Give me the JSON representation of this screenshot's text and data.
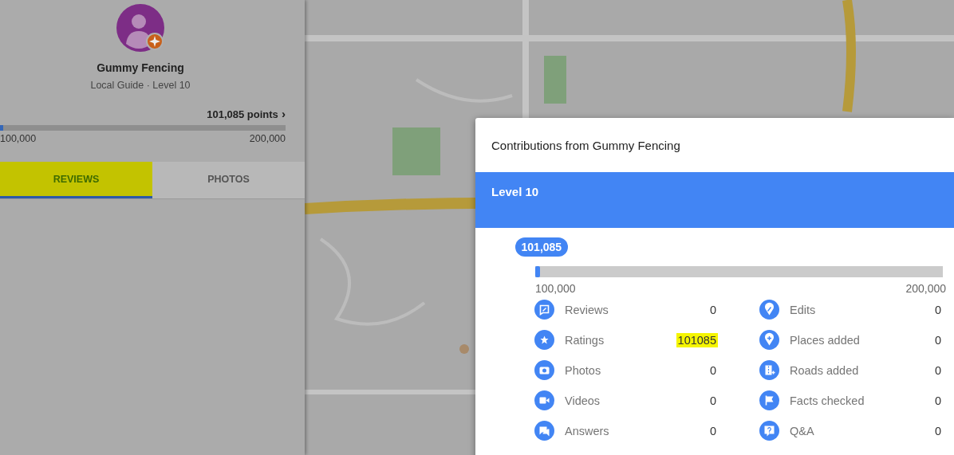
{
  "profile": {
    "name": "Gummy Fencing",
    "subtitle": "Local Guide · Level 10",
    "points": "101,085 points",
    "points_arrow": "›",
    "progress": {
      "level": 0.01085,
      "min_label": "100,000",
      "max_label": "200,000"
    }
  },
  "tabs": [
    {
      "label": "REVIEWS",
      "selected": true,
      "highlighted": true
    },
    {
      "label": "PHOTOS",
      "selected": false,
      "highlighted": false
    }
  ],
  "dialog": {
    "title": "Contributions from Gummy Fencing",
    "level_title": "Level 10",
    "bubble": "101,085",
    "progress": {
      "level": 0.01085,
      "min_label": "100,000",
      "max_label": "200,000"
    },
    "stats": [
      {
        "kind": "review",
        "label": "Reviews",
        "value": "0",
        "highlighted": false
      },
      {
        "kind": "edit",
        "label": "Edits",
        "value": "0",
        "highlighted": false
      },
      {
        "kind": "star",
        "label": "Ratings",
        "value": "101085",
        "highlighted": true
      },
      {
        "kind": "pin",
        "label": "Places added",
        "value": "0",
        "highlighted": false
      },
      {
        "kind": "camera",
        "label": "Photos",
        "value": "0",
        "highlighted": false
      },
      {
        "kind": "road",
        "label": "Roads added",
        "value": "0",
        "highlighted": false
      },
      {
        "kind": "video",
        "label": "Videos",
        "value": "0",
        "highlighted": false
      },
      {
        "kind": "flag",
        "label": "Facts checked",
        "value": "0",
        "highlighted": false
      },
      {
        "kind": "chat",
        "label": "Answers",
        "value": "0",
        "highlighted": false
      },
      {
        "kind": "question",
        "label": "Q&A",
        "value": "0",
        "highlighted": false
      }
    ]
  }
}
